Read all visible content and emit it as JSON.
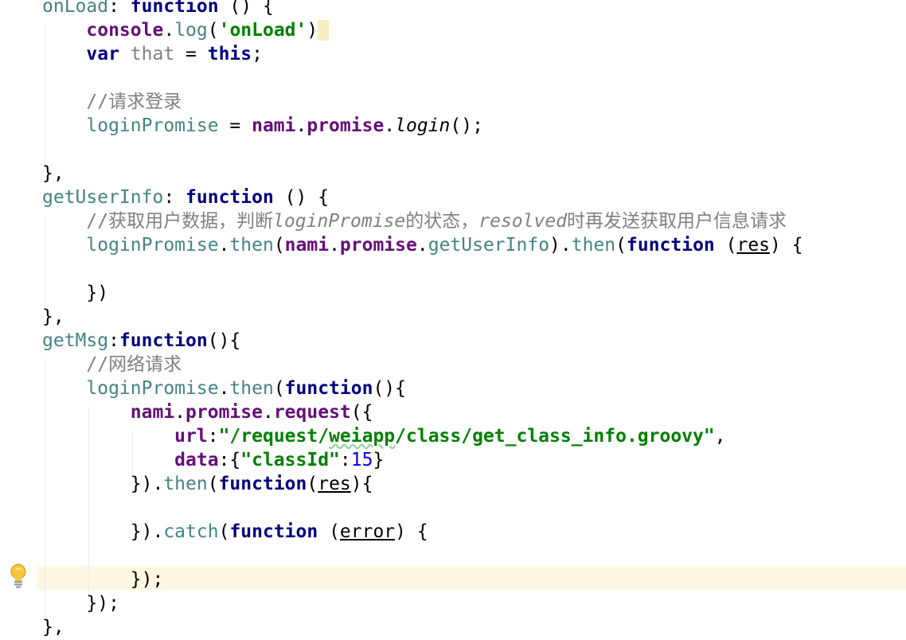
{
  "editor": {
    "lines": [
      {
        "tokens": [
          {
            "t": "pname",
            "v": "onLoad"
          },
          {
            "t": "plain",
            "v": ": "
          },
          {
            "t": "kw",
            "v": "function"
          },
          {
            "t": "plain",
            "v": " () {"
          }
        ]
      },
      {
        "tokens": [
          {
            "t": "plain",
            "v": "    "
          },
          {
            "t": "prop",
            "v": "console"
          },
          {
            "t": "plain",
            "v": "."
          },
          {
            "t": "meth",
            "v": "log"
          },
          {
            "t": "plain",
            "v": "("
          },
          {
            "t": "str",
            "v": "'onLoad'"
          },
          {
            "t": "plain",
            "v": ")"
          },
          {
            "t": "hl",
            "v": " "
          }
        ]
      },
      {
        "tokens": [
          {
            "t": "plain",
            "v": "    "
          },
          {
            "t": "kw",
            "v": "var"
          },
          {
            "t": "plain",
            "v": " "
          },
          {
            "t": "unused",
            "v": "that"
          },
          {
            "t": "plain",
            "v": " = "
          },
          {
            "t": "kw",
            "v": "this"
          },
          {
            "t": "plain",
            "v": ";"
          }
        ]
      },
      {
        "tokens": []
      },
      {
        "tokens": [
          {
            "t": "plain",
            "v": "    "
          },
          {
            "t": "cmt",
            "v": "//请求登录"
          }
        ]
      },
      {
        "tokens": [
          {
            "t": "plain",
            "v": "    "
          },
          {
            "t": "pname",
            "v": "loginPromise"
          },
          {
            "t": "plain",
            "v": " = "
          },
          {
            "t": "prop",
            "v": "nami"
          },
          {
            "t": "plain",
            "v": "."
          },
          {
            "t": "prop",
            "v": "promise"
          },
          {
            "t": "plain",
            "v": "."
          },
          {
            "t": "ital",
            "v": "login"
          },
          {
            "t": "plain",
            "v": "();"
          }
        ]
      },
      {
        "tokens": []
      },
      {
        "tokens": [
          {
            "t": "plain",
            "v": "},"
          }
        ]
      },
      {
        "tokens": [
          {
            "t": "pname",
            "v": "getUserInfo"
          },
          {
            "t": "plain",
            "v": ": "
          },
          {
            "t": "kw",
            "v": "function"
          },
          {
            "t": "plain",
            "v": " () {"
          }
        ]
      },
      {
        "tokens": [
          {
            "t": "plain",
            "v": "    "
          },
          {
            "t": "cmt",
            "v": "//获取用户数据，判断"
          },
          {
            "t": "cmti",
            "v": "loginPromise"
          },
          {
            "t": "cmt",
            "v": "的状态，"
          },
          {
            "t": "cmti",
            "v": "resolved"
          },
          {
            "t": "cmt",
            "v": "时再发送获取用户信息请求"
          }
        ]
      },
      {
        "tokens": [
          {
            "t": "plain",
            "v": "    "
          },
          {
            "t": "pname",
            "v": "loginPromise"
          },
          {
            "t": "plain",
            "v": "."
          },
          {
            "t": "meth",
            "v": "then"
          },
          {
            "t": "plain",
            "v": "("
          },
          {
            "t": "prop",
            "v": "nami"
          },
          {
            "t": "plain",
            "v": "."
          },
          {
            "t": "prop",
            "v": "promise"
          },
          {
            "t": "plain",
            "v": "."
          },
          {
            "t": "meth",
            "v": "getUserInfo"
          },
          {
            "t": "plain",
            "v": ")."
          },
          {
            "t": "meth",
            "v": "then"
          },
          {
            "t": "plain",
            "v": "("
          },
          {
            "t": "kw",
            "v": "function"
          },
          {
            "t": "plain",
            "v": " ("
          },
          {
            "t": "uline",
            "v": "res"
          },
          {
            "t": "plain",
            "v": ") {"
          }
        ]
      },
      {
        "tokens": []
      },
      {
        "tokens": [
          {
            "t": "plain",
            "v": "    })"
          }
        ]
      },
      {
        "tokens": [
          {
            "t": "plain",
            "v": "},"
          }
        ]
      },
      {
        "tokens": [
          {
            "t": "pname",
            "v": "getMsg"
          },
          {
            "t": "plain",
            "v": ":"
          },
          {
            "t": "kw",
            "v": "function"
          },
          {
            "t": "plain",
            "v": "(){"
          }
        ]
      },
      {
        "tokens": [
          {
            "t": "plain",
            "v": "    "
          },
          {
            "t": "cmt",
            "v": "//网络请求"
          }
        ]
      },
      {
        "tokens": [
          {
            "t": "plain",
            "v": "    "
          },
          {
            "t": "pname",
            "v": "loginPromise"
          },
          {
            "t": "plain",
            "v": "."
          },
          {
            "t": "meth",
            "v": "then"
          },
          {
            "t": "plain",
            "v": "("
          },
          {
            "t": "kw",
            "v": "function"
          },
          {
            "t": "plain",
            "v": "(){"
          }
        ]
      },
      {
        "tokens": [
          {
            "t": "plain",
            "v": "        "
          },
          {
            "t": "prop",
            "v": "nami"
          },
          {
            "t": "plain",
            "v": "."
          },
          {
            "t": "prop",
            "v": "promise"
          },
          {
            "t": "plain",
            "v": "."
          },
          {
            "t": "prop",
            "v": "request"
          },
          {
            "t": "plain",
            "v": "({"
          }
        ]
      },
      {
        "tokens": [
          {
            "t": "plain",
            "v": "            "
          },
          {
            "t": "prop",
            "v": "url"
          },
          {
            "t": "plain",
            "v": ":"
          },
          {
            "t": "str",
            "v": "\"/request/"
          },
          {
            "t": "strw",
            "v": "weiapp"
          },
          {
            "t": "str",
            "v": "/class/get_class_info.groovy\""
          },
          {
            "t": "plain",
            "v": ","
          }
        ]
      },
      {
        "tokens": [
          {
            "t": "plain",
            "v": "            "
          },
          {
            "t": "prop",
            "v": "data"
          },
          {
            "t": "plain",
            "v": ":{"
          },
          {
            "t": "str",
            "v": "\"classId\""
          },
          {
            "t": "plain",
            "v": ":"
          },
          {
            "t": "num",
            "v": "15"
          },
          {
            "t": "plain",
            "v": "}"
          }
        ]
      },
      {
        "tokens": [
          {
            "t": "plain",
            "v": "        })."
          },
          {
            "t": "meth",
            "v": "then"
          },
          {
            "t": "plain",
            "v": "("
          },
          {
            "t": "kw",
            "v": "function"
          },
          {
            "t": "plain",
            "v": "("
          },
          {
            "t": "uline",
            "v": "res"
          },
          {
            "t": "plain",
            "v": "){"
          }
        ]
      },
      {
        "tokens": []
      },
      {
        "tokens": [
          {
            "t": "plain",
            "v": "        })."
          },
          {
            "t": "meth",
            "v": "catch"
          },
          {
            "t": "plain",
            "v": "("
          },
          {
            "t": "kw",
            "v": "function"
          },
          {
            "t": "plain",
            "v": " ("
          },
          {
            "t": "uline",
            "v": "error"
          },
          {
            "t": "plain",
            "v": ") {"
          }
        ]
      },
      {
        "tokens": []
      },
      {
        "tokens": [
          {
            "t": "plain",
            "v": "        });"
          }
        ]
      },
      {
        "tokens": [
          {
            "t": "plain",
            "v": "    });"
          }
        ]
      },
      {
        "tokens": [
          {
            "t": "plain",
            "v": "},"
          }
        ]
      }
    ],
    "intention_icon": "lightbulb-icon",
    "current_line_index": 24,
    "colors": {
      "keyword": "#000080",
      "property": "#660e7a",
      "identifier": "#458383",
      "string": "#008000",
      "number": "#0000ff",
      "comment": "#808080",
      "current_line": "#fcf8e1"
    }
  }
}
